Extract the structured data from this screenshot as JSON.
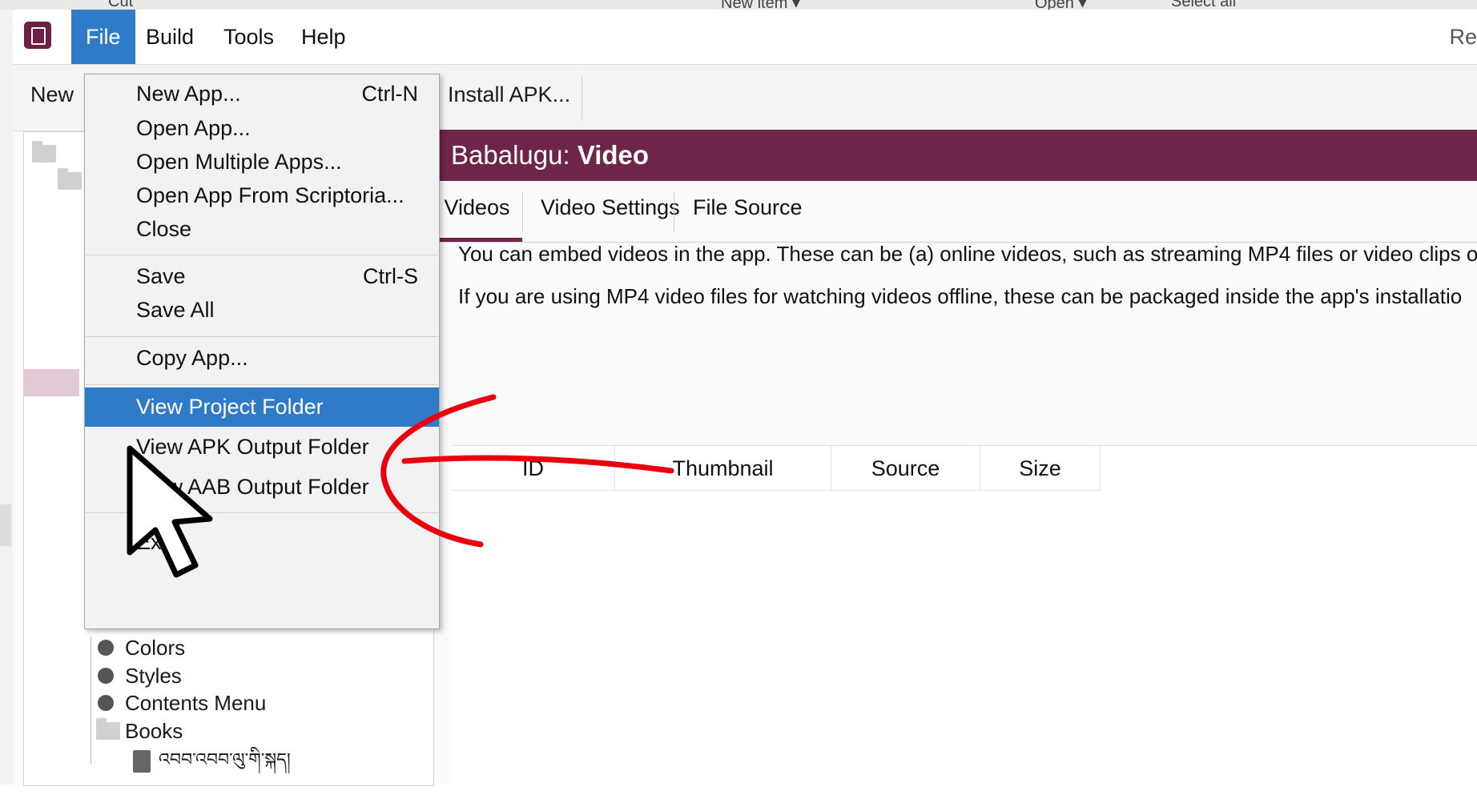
{
  "background_toolbar": {
    "cut": "Cut",
    "new_item": "New item ▾",
    "open": "Open ▾",
    "select_all": "Select all"
  },
  "menubar": {
    "items": [
      "File",
      "Build",
      "Tools",
      "Help"
    ],
    "right_text": "Re"
  },
  "toolbar": {
    "new_label": "New",
    "install_label": "Install APK..."
  },
  "page": {
    "title_prefix": "Babalugu: ",
    "title_bold": "Video"
  },
  "tabs": [
    "Videos",
    "Video Settings",
    "File Source"
  ],
  "description": {
    "line1": "You can embed videos in the app. These can be (a) online videos, such as streaming MP4 files or video clips o",
    "line2": "If you are using MP4 video files for watching videos offline, these can be packaged inside the app's installatio"
  },
  "table": {
    "columns": [
      "ID",
      "Thumbnail",
      "Source",
      "Size"
    ]
  },
  "tree": {
    "items": [
      "Colors",
      "Styles",
      "Contents Menu",
      "Books",
      "འབབ་འབབ་ལུ་གི་སྐད།"
    ]
  },
  "file_menu": {
    "groups": [
      [
        {
          "label": "New App...",
          "shortcut": "Ctrl-N"
        },
        {
          "label": "Open App...",
          "shortcut": ""
        },
        {
          "label": "Open Multiple Apps...",
          "shortcut": ""
        },
        {
          "label": "Open App From Scriptoria...",
          "shortcut": ""
        },
        {
          "label": "Close",
          "shortcut": ""
        }
      ],
      [
        {
          "label": "Save",
          "shortcut": "Ctrl-S"
        },
        {
          "label": "Save All",
          "shortcut": ""
        }
      ],
      [
        {
          "label": "Copy App...",
          "shortcut": ""
        }
      ],
      [
        {
          "label": "View Project Folder",
          "shortcut": ""
        },
        {
          "label": "View APK Output Folder",
          "shortcut": ""
        },
        {
          "label": "View AAB Output Folder",
          "shortcut": ""
        }
      ],
      [
        {
          "label": "Exit",
          "shortcut": ""
        }
      ]
    ],
    "highlighted": "View Project Folder"
  },
  "colors": {
    "accent": "#6e2549",
    "menu_highlight": "#2f7bc8",
    "annotation": "#e8000f"
  },
  "icons": [
    "app-logo-icon",
    "mouse-cursor-icon",
    "folder-icon",
    "book-icon",
    "bullet-icon"
  ]
}
